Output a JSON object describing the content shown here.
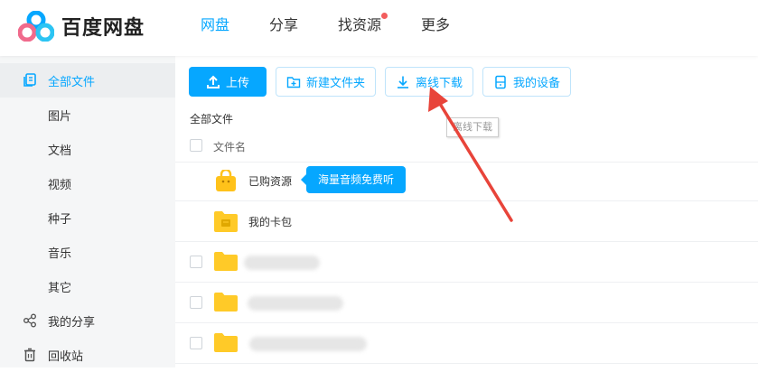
{
  "app": {
    "title": "百度网盘"
  },
  "topnav": {
    "items": [
      {
        "label": "网盘",
        "active": true
      },
      {
        "label": "分享",
        "active": false
      },
      {
        "label": "找资源",
        "active": false,
        "dot": true
      },
      {
        "label": "更多",
        "active": false
      }
    ]
  },
  "sidebar": {
    "items": [
      {
        "label": "全部文件",
        "icon": "files-icon",
        "active": true
      },
      {
        "label": "图片"
      },
      {
        "label": "文档"
      },
      {
        "label": "视频"
      },
      {
        "label": "种子"
      },
      {
        "label": "音乐"
      },
      {
        "label": "其它"
      },
      {
        "label": "我的分享",
        "icon": "share-icon"
      },
      {
        "label": "回收站",
        "icon": "trash-icon"
      }
    ]
  },
  "toolbar": {
    "upload": "上传",
    "new_folder": "新建文件夹",
    "offline_download": "离线下载",
    "my_devices": "我的设备"
  },
  "breadcrumb": "全部文件",
  "tooltip_offline": "离线下载",
  "list": {
    "header": "文件名",
    "rows": [
      {
        "name": "已购资源",
        "type": "purchased"
      },
      {
        "name": "我的卡包",
        "type": "cardpack"
      },
      {
        "name": "",
        "type": "folder",
        "blurred": true
      },
      {
        "name": "",
        "type": "folder",
        "blurred": true
      },
      {
        "name": "",
        "type": "folder",
        "blurred": true
      }
    ]
  },
  "promo_tip": "海量音频免费听",
  "colors": {
    "accent": "#06a7ff",
    "annotation_arrow": "#e8443a",
    "folder": "#ffca28"
  }
}
